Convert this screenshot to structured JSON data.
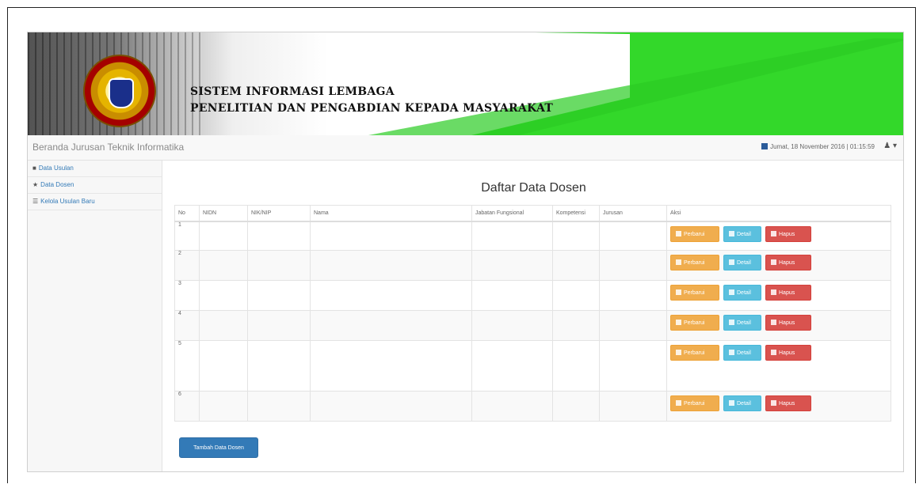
{
  "header": {
    "title_line1": "SISTEM INFORMASI LEMBAGA",
    "title_line2": "PENELITIAN DAN PENGABDIAN KEPADA MASYARAKAT"
  },
  "navbar": {
    "brand": "Beranda Jurusan Teknik Informatika",
    "datetime": "Jumat, 18 November 2016 | 01:15:59",
    "user_icon": "user-icon"
  },
  "sidebar": {
    "items": [
      {
        "icon": "book-icon",
        "label": "Data Usulan"
      },
      {
        "icon": "star-icon",
        "label": "Data Dosen"
      },
      {
        "icon": "list-icon",
        "label": "Kelola Usulan Baru"
      }
    ]
  },
  "main": {
    "title": "Daftar Data Dosen",
    "columns": [
      "No",
      "NIDN",
      "NIK/NIP",
      "Nama",
      "Jabatan Fungsional",
      "Kompetensi",
      "Jurusan",
      "Aksi"
    ],
    "rows": [
      {
        "no": "1"
      },
      {
        "no": "2"
      },
      {
        "no": "3"
      },
      {
        "no": "4"
      },
      {
        "no": "5"
      },
      {
        "no": "6"
      }
    ],
    "buttons": {
      "edit": "Perbarui",
      "detail": "Detail",
      "delete": "Hapus"
    },
    "add_button": "Tambah Data Dosen"
  },
  "colors": {
    "banner_green": "#33d82a",
    "primary": "#337ab7",
    "warning": "#f0ad4e",
    "info": "#5bc0de",
    "danger": "#d9534f"
  }
}
